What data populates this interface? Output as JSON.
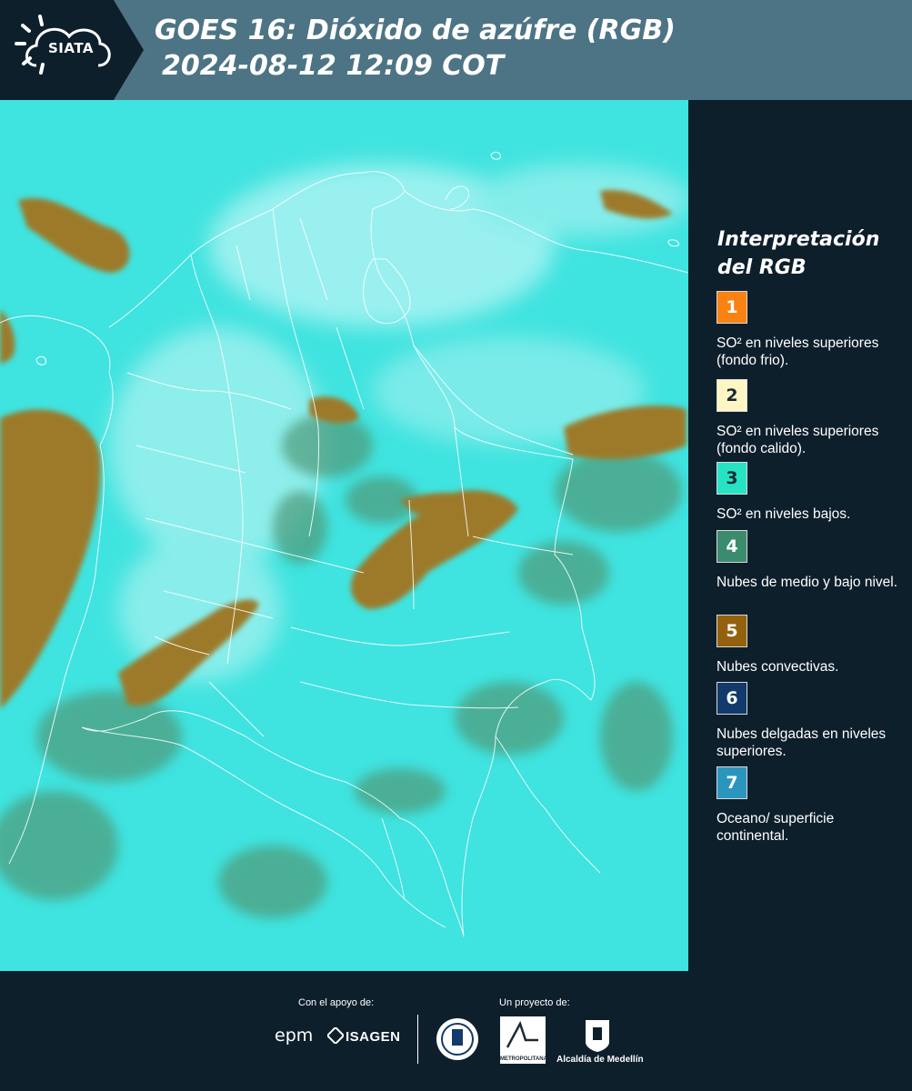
{
  "header": {
    "logo_text": "SIATA",
    "title_line1": "GOES 16: Dióxido de azúfre (RGB)",
    "title_line2": "2024-08-12 12:09 COT"
  },
  "colors": {
    "header_bg": "#4d7485",
    "panel_bg": "#0e1f2c",
    "map_cyan": "#38e0dc",
    "cloud_brown": "#9c7a2c",
    "cloud_green": "#4f9a78"
  },
  "legend": {
    "title": "Interpretación del RGB",
    "items": [
      {
        "num": "1",
        "color": "#f98212",
        "text": "SO² en niveles superiores (fondo frio)."
      },
      {
        "num": "2",
        "color": "#fdf6c4",
        "text": "SO² en niveles superiores (fondo calido)."
      },
      {
        "num": "3",
        "color": "#26e3c4",
        "text": "SO² en niveles bajos."
      },
      {
        "num": "4",
        "color": "#3b8c6c",
        "text": "Nubes de medio y bajo nivel."
      },
      {
        "num": "5",
        "color": "#94610f",
        "text": "Nubes convectivas."
      },
      {
        "num": "6",
        "color": "#123a6a",
        "text": "Nubes delgadas en niveles superiores."
      },
      {
        "num": "7",
        "color": "#2a96be",
        "text": "Oceano/ superficie continental."
      }
    ]
  },
  "footer": {
    "support_label": "Con el apoyo de:",
    "project_label": "Un proyecto de:",
    "epm": "epm",
    "isagen": "ISAGEN",
    "area_text": "METROPOLITANA",
    "medellin": "Alcaldía de Medellín"
  }
}
